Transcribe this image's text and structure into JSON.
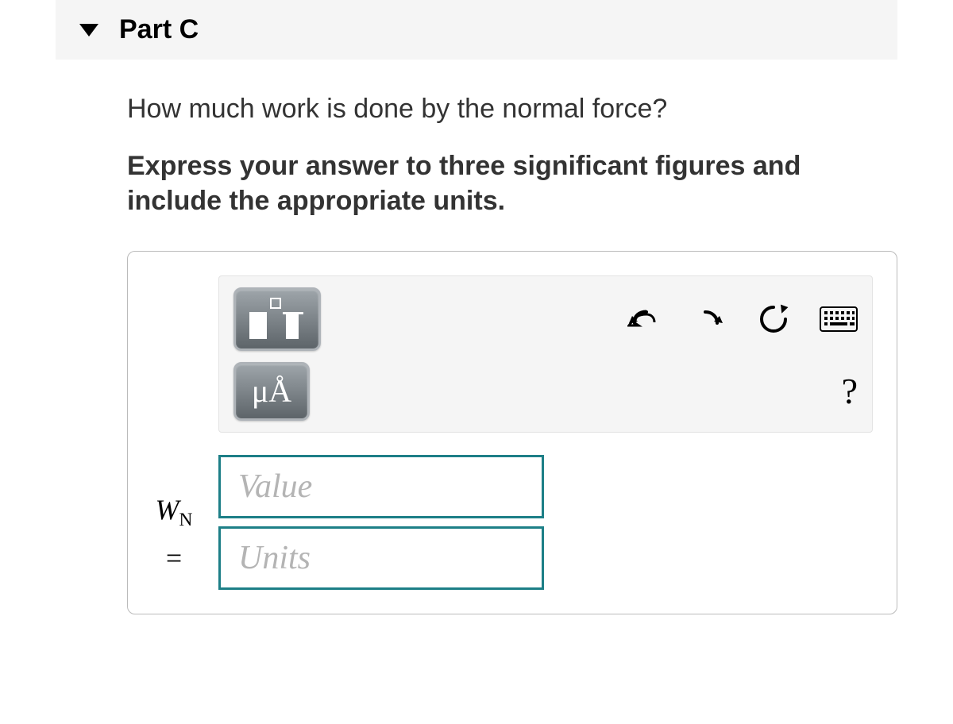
{
  "part": {
    "label": "Part C"
  },
  "question": "How much work is done by the normal force?",
  "instructions": "Express your answer to three significant figures and include the appropriate units.",
  "variable": {
    "base": "W",
    "sub": "N",
    "equals": "="
  },
  "toolbar": {
    "units_button": "μÅ",
    "help": "?"
  },
  "inputs": {
    "value_placeholder": "Value",
    "units_placeholder": "Units"
  }
}
